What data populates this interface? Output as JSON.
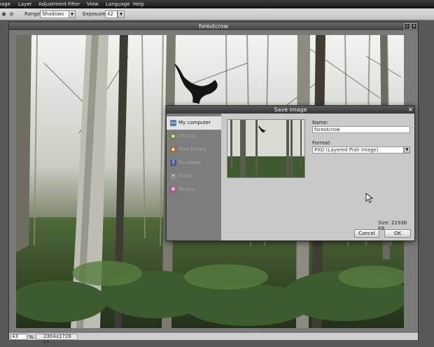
{
  "menubar": {
    "items": [
      "Image",
      "Layer",
      "Adjustment",
      "Filter",
      "View",
      "Language",
      "Help"
    ]
  },
  "toolbar": {
    "range_label": "Range:",
    "range_value": "Shadows",
    "exposure_label": "Exposure:",
    "exposure_value": "42"
  },
  "document": {
    "title": "forestcrow",
    "zoom_value": "43",
    "zoom_unit": "%",
    "image_size": "2304x1728 px"
  },
  "dialog": {
    "title": "Save image",
    "sidebar": [
      {
        "label": "My computer",
        "icon": "computer-icon",
        "active": true
      },
      {
        "label": "Imm.io",
        "icon": "immio-icon",
        "active": false
      },
      {
        "label": "Pixlr library",
        "icon": "pixlr-library-icon",
        "active": false
      },
      {
        "label": "Facebook",
        "icon": "facebook-icon",
        "active": false
      },
      {
        "label": "Flickr",
        "icon": "flickr-icon",
        "active": false
      },
      {
        "label": "Picasa",
        "icon": "picasa-icon",
        "active": false
      }
    ],
    "name_label": "Name:",
    "name_value": "forestcrow",
    "format_label": "Format:",
    "format_value": "PXD (Layered Pixlr image)",
    "size_text": "Size: 21936 KB",
    "cancel_label": "Cancel",
    "ok_label": "OK"
  }
}
